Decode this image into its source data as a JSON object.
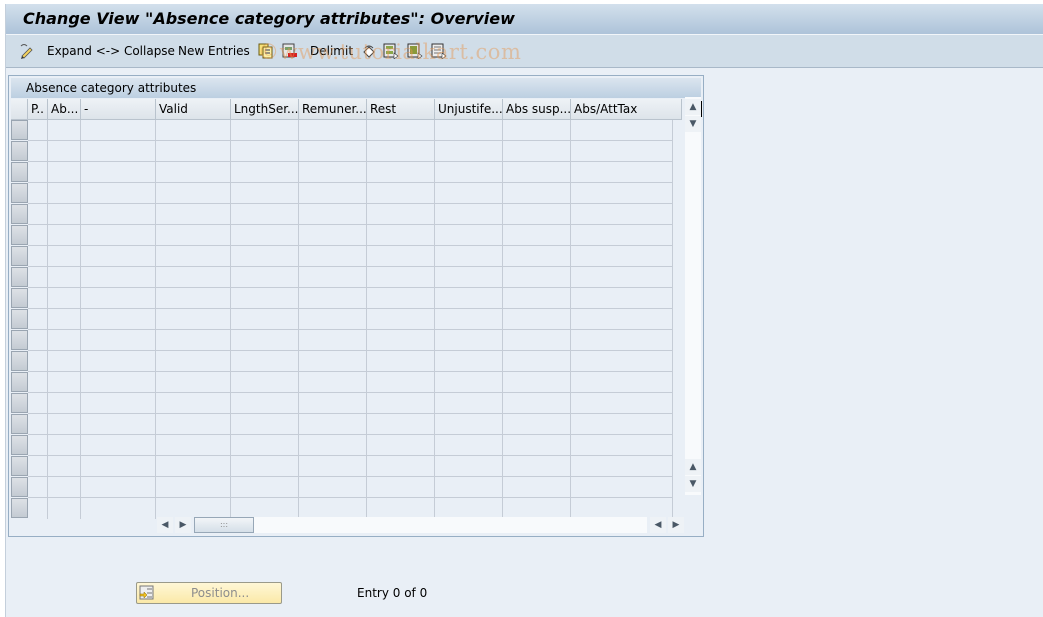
{
  "window": {
    "title": "Change View \"Absence category attributes\": Overview"
  },
  "toolbar": {
    "items": [
      {
        "type": "icon",
        "name": "change-display-icon"
      },
      {
        "type": "button",
        "label": "Expand <-> Collapse"
      },
      {
        "type": "button",
        "label": "New Entries"
      },
      {
        "type": "icon",
        "name": "copy-as-icon"
      },
      {
        "type": "icon",
        "name": "delete-icon"
      },
      {
        "type": "button",
        "label": "Delimit"
      },
      {
        "type": "icon",
        "name": "undo-change-icon"
      },
      {
        "type": "icon",
        "name": "select-all-icon"
      },
      {
        "type": "icon",
        "name": "select-block-icon"
      },
      {
        "type": "icon",
        "name": "deselect-all-icon"
      }
    ],
    "expand_label": "Expand <-> Collapse",
    "new_entries_label": "New Entries",
    "delimit_label": "Delimit",
    "watermark": "©www.tutorialkart.com"
  },
  "table": {
    "title": "Absence category attributes",
    "columns": [
      "P..",
      "Ab...",
      "-",
      "Valid",
      "LngthSer...",
      "Remuner...",
      "Rest",
      "Unjustife...",
      "Abs susp...",
      "Abs/AttTax"
    ],
    "row_count_visible": 19,
    "rows": []
  },
  "footer": {
    "position_button": "Position...",
    "entry_text": "Entry 0 of 0"
  }
}
